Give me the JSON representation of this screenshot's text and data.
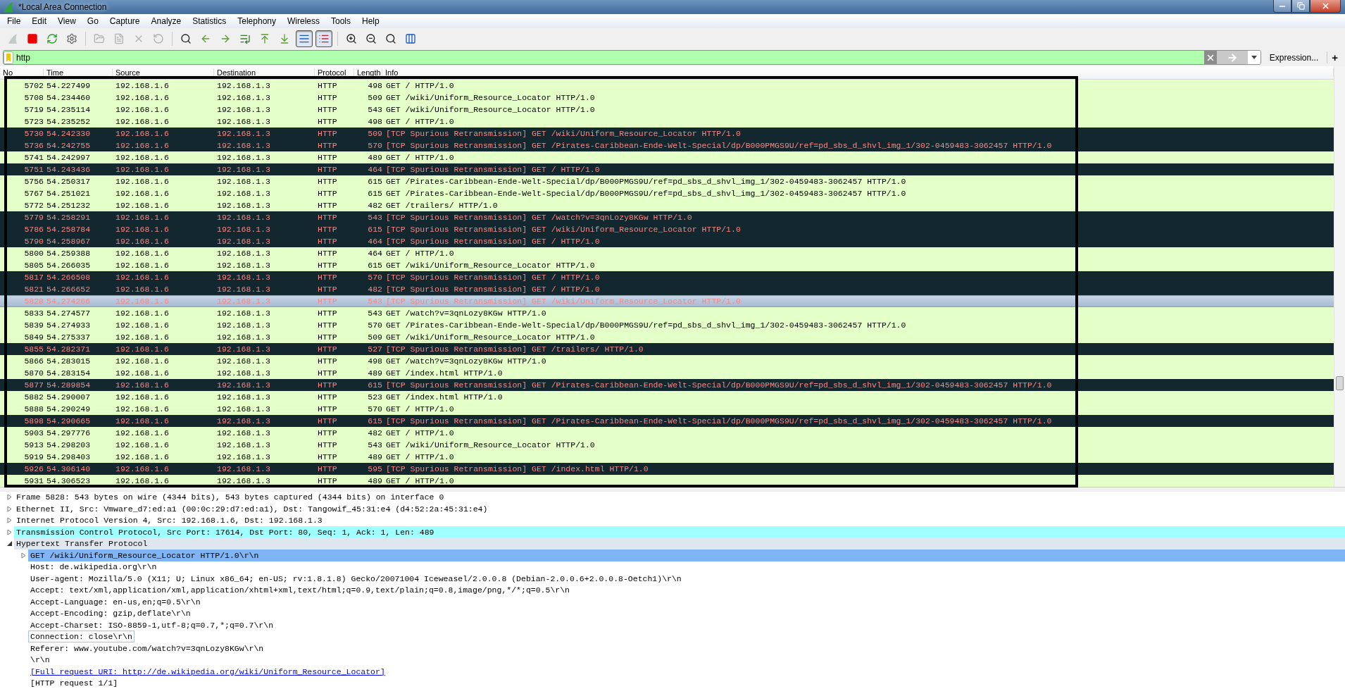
{
  "window": {
    "title": "*Local Area Connection"
  },
  "menu": [
    "File",
    "Edit",
    "View",
    "Go",
    "Capture",
    "Analyze",
    "Statistics",
    "Telephony",
    "Wireless",
    "Tools",
    "Help"
  ],
  "toolbar": [
    {
      "pressed": false,
      "disabled": true
    },
    {
      "pressed": false,
      "disabled": false
    },
    {
      "pressed": false,
      "disabled": false
    },
    {
      "pressed": false,
      "disabled": false
    },
    {
      "pressed": false,
      "disabled": true
    },
    {
      "pressed": false,
      "disabled": true
    },
    {
      "pressed": false,
      "disabled": true
    },
    {
      "pressed": false,
      "disabled": true
    },
    {
      "pressed": false,
      "disabled": false
    },
    {
      "pressed": false,
      "disabled": false
    },
    {
      "pressed": false,
      "disabled": false
    },
    {
      "pressed": false,
      "disabled": false
    },
    {
      "pressed": false,
      "disabled": false
    },
    {
      "pressed": false,
      "disabled": false
    },
    {
      "pressed": true,
      "disabled": false
    },
    {
      "pressed": true,
      "disabled": false
    },
    {
      "pressed": false,
      "disabled": false
    },
    {
      "pressed": false,
      "disabled": false
    },
    {
      "pressed": false,
      "disabled": false
    },
    {
      "pressed": false,
      "disabled": false
    }
  ],
  "filter": {
    "value": "http",
    "expression_button": "Expression...",
    "add_button": "+"
  },
  "packet_list": {
    "columns": [
      "No",
      "Time",
      "Source",
      "Destination",
      "Protocol",
      "Length",
      "Info"
    ],
    "rows": [
      {
        "no": "5702",
        "time": "54.227499",
        "source": "192.168.1.6",
        "destination": "192.168.1.3",
        "protocol": "HTTP",
        "length": "498",
        "info": "GET / HTTP/1.0",
        "kind": "normal",
        "selected": false
      },
      {
        "no": "5708",
        "time": "54.234460",
        "source": "192.168.1.6",
        "destination": "192.168.1.3",
        "protocol": "HTTP",
        "length": "509",
        "info": "GET /wiki/Uniform_Resource_Locator HTTP/1.0",
        "kind": "normal",
        "selected": false
      },
      {
        "no": "5719",
        "time": "54.235114",
        "source": "192.168.1.6",
        "destination": "192.168.1.3",
        "protocol": "HTTP",
        "length": "543",
        "info": "GET /wiki/Uniform_Resource_Locator HTTP/1.0",
        "kind": "normal",
        "selected": false
      },
      {
        "no": "5723",
        "time": "54.235252",
        "source": "192.168.1.6",
        "destination": "192.168.1.3",
        "protocol": "HTTP",
        "length": "498",
        "info": "GET / HTTP/1.0",
        "kind": "normal",
        "selected": false
      },
      {
        "no": "5730",
        "time": "54.242330",
        "source": "192.168.1.6",
        "destination": "192.168.1.3",
        "protocol": "HTTP",
        "length": "509",
        "info": "[TCP Spurious Retransmission] GET /wiki/Uniform_Resource_Locator HTTP/1.0",
        "kind": "retransmission",
        "selected": false
      },
      {
        "no": "5736",
        "time": "54.242755",
        "source": "192.168.1.6",
        "destination": "192.168.1.3",
        "protocol": "HTTP",
        "length": "570",
        "info": "[TCP Spurious Retransmission] GET /Pirates-Caribbean-Ende-Welt-Special/dp/B000PMGS9U/ref=pd_sbs_d_shvl_img_1/302-0459483-3062457 HTTP/1.0",
        "kind": "retransmission",
        "selected": false
      },
      {
        "no": "5741",
        "time": "54.242997",
        "source": "192.168.1.6",
        "destination": "192.168.1.3",
        "protocol": "HTTP",
        "length": "489",
        "info": "GET / HTTP/1.0",
        "kind": "normal",
        "selected": false
      },
      {
        "no": "5751",
        "time": "54.243436",
        "source": "192.168.1.6",
        "destination": "192.168.1.3",
        "protocol": "HTTP",
        "length": "464",
        "info": "[TCP Spurious Retransmission] GET / HTTP/1.0",
        "kind": "retransmission",
        "selected": false
      },
      {
        "no": "5756",
        "time": "54.250317",
        "source": "192.168.1.6",
        "destination": "192.168.1.3",
        "protocol": "HTTP",
        "length": "615",
        "info": "GET /Pirates-Caribbean-Ende-Welt-Special/dp/B000PMGS9U/ref=pd_sbs_d_shvl_img_1/302-0459483-3062457 HTTP/1.0",
        "kind": "normal",
        "selected": false
      },
      {
        "no": "5767",
        "time": "54.251021",
        "source": "192.168.1.6",
        "destination": "192.168.1.3",
        "protocol": "HTTP",
        "length": "615",
        "info": "GET /Pirates-Caribbean-Ende-Welt-Special/dp/B000PMGS9U/ref=pd_sbs_d_shvl_img_1/302-0459483-3062457 HTTP/1.0",
        "kind": "normal",
        "selected": false
      },
      {
        "no": "5772",
        "time": "54.251232",
        "source": "192.168.1.6",
        "destination": "192.168.1.3",
        "protocol": "HTTP",
        "length": "482",
        "info": "GET /trailers/ HTTP/1.0",
        "kind": "normal",
        "selected": false
      },
      {
        "no": "5779",
        "time": "54.258291",
        "source": "192.168.1.6",
        "destination": "192.168.1.3",
        "protocol": "HTTP",
        "length": "543",
        "info": "[TCP Spurious Retransmission] GET /watch?v=3qnLozy8KGw HTTP/1.0",
        "kind": "retransmission",
        "selected": false
      },
      {
        "no": "5786",
        "time": "54.258784",
        "source": "192.168.1.6",
        "destination": "192.168.1.3",
        "protocol": "HTTP",
        "length": "615",
        "info": "[TCP Spurious Retransmission] GET /wiki/Uniform_Resource_Locator HTTP/1.0",
        "kind": "retransmission",
        "selected": false
      },
      {
        "no": "5790",
        "time": "54.258967",
        "source": "192.168.1.6",
        "destination": "192.168.1.3",
        "protocol": "HTTP",
        "length": "464",
        "info": "[TCP Spurious Retransmission] GET / HTTP/1.0",
        "kind": "retransmission",
        "selected": false
      },
      {
        "no": "5800",
        "time": "54.259388",
        "source": "192.168.1.6",
        "destination": "192.168.1.3",
        "protocol": "HTTP",
        "length": "464",
        "info": "GET / HTTP/1.0",
        "kind": "normal",
        "selected": false
      },
      {
        "no": "5805",
        "time": "54.266035",
        "source": "192.168.1.6",
        "destination": "192.168.1.3",
        "protocol": "HTTP",
        "length": "615",
        "info": "GET /wiki/Uniform_Resource_Locator HTTP/1.0",
        "kind": "normal",
        "selected": false
      },
      {
        "no": "5817",
        "time": "54.266508",
        "source": "192.168.1.6",
        "destination": "192.168.1.3",
        "protocol": "HTTP",
        "length": "570",
        "info": "[TCP Spurious Retransmission] GET / HTTP/1.0",
        "kind": "retransmission",
        "selected": false
      },
      {
        "no": "5821",
        "time": "54.266652",
        "source": "192.168.1.6",
        "destination": "192.168.1.3",
        "protocol": "HTTP",
        "length": "482",
        "info": "[TCP Spurious Retransmission] GET / HTTP/1.0",
        "kind": "retransmission",
        "selected": false
      },
      {
        "no": "5828",
        "time": "54.274266",
        "source": "192.168.1.6",
        "destination": "192.168.1.3",
        "protocol": "HTTP",
        "length": "543",
        "info": "[TCP Spurious Retransmission] GET /wiki/Uniform_Resource_Locator HTTP/1.0",
        "kind": "retransmission",
        "selected": true
      },
      {
        "no": "5833",
        "time": "54.274577",
        "source": "192.168.1.6",
        "destination": "192.168.1.3",
        "protocol": "HTTP",
        "length": "543",
        "info": "GET /watch?v=3qnLozy8KGw HTTP/1.0",
        "kind": "normal",
        "selected": false
      },
      {
        "no": "5839",
        "time": "54.274933",
        "source": "192.168.1.6",
        "destination": "192.168.1.3",
        "protocol": "HTTP",
        "length": "570",
        "info": "GET /Pirates-Caribbean-Ende-Welt-Special/dp/B000PMGS9U/ref=pd_sbs_d_shvl_img_1/302-0459483-3062457 HTTP/1.0",
        "kind": "normal",
        "selected": false
      },
      {
        "no": "5849",
        "time": "54.275337",
        "source": "192.168.1.6",
        "destination": "192.168.1.3",
        "protocol": "HTTP",
        "length": "509",
        "info": "GET /wiki/Uniform_Resource_Locator HTTP/1.0",
        "kind": "normal",
        "selected": false
      },
      {
        "no": "5855",
        "time": "54.282371",
        "source": "192.168.1.6",
        "destination": "192.168.1.3",
        "protocol": "HTTP",
        "length": "527",
        "info": "[TCP Spurious Retransmission] GET /trailers/ HTTP/1.0",
        "kind": "retransmission",
        "selected": false
      },
      {
        "no": "5866",
        "time": "54.283015",
        "source": "192.168.1.6",
        "destination": "192.168.1.3",
        "protocol": "HTTP",
        "length": "498",
        "info": "GET /watch?v=3qnLozy8KGw HTTP/1.0",
        "kind": "normal",
        "selected": false
      },
      {
        "no": "5870",
        "time": "54.283154",
        "source": "192.168.1.6",
        "destination": "192.168.1.3",
        "protocol": "HTTP",
        "length": "489",
        "info": "GET /index.html HTTP/1.0",
        "kind": "normal",
        "selected": false
      },
      {
        "no": "5877",
        "time": "54.289854",
        "source": "192.168.1.6",
        "destination": "192.168.1.3",
        "protocol": "HTTP",
        "length": "615",
        "info": "[TCP Spurious Retransmission] GET /Pirates-Caribbean-Ende-Welt-Special/dp/B000PMGS9U/ref=pd_sbs_d_shvl_img_1/302-0459483-3062457 HTTP/1.0",
        "kind": "retransmission",
        "selected": false
      },
      {
        "no": "5882",
        "time": "54.290007",
        "source": "192.168.1.6",
        "destination": "192.168.1.3",
        "protocol": "HTTP",
        "length": "523",
        "info": "GET /index.html HTTP/1.0",
        "kind": "normal",
        "selected": false
      },
      {
        "no": "5888",
        "time": "54.290249",
        "source": "192.168.1.6",
        "destination": "192.168.1.3",
        "protocol": "HTTP",
        "length": "570",
        "info": "GET / HTTP/1.0",
        "kind": "normal",
        "selected": false
      },
      {
        "no": "5898",
        "time": "54.290665",
        "source": "192.168.1.6",
        "destination": "192.168.1.3",
        "protocol": "HTTP",
        "length": "615",
        "info": "[TCP Spurious Retransmission] GET /Pirates-Caribbean-Ende-Welt-Special/dp/B000PMGS9U/ref=pd_sbs_d_shvl_img_1/302-0459483-3062457 HTTP/1.0",
        "kind": "retransmission",
        "selected": false
      },
      {
        "no": "5903",
        "time": "54.297776",
        "source": "192.168.1.6",
        "destination": "192.168.1.3",
        "protocol": "HTTP",
        "length": "482",
        "info": "GET / HTTP/1.0",
        "kind": "normal",
        "selected": false
      },
      {
        "no": "5913",
        "time": "54.298203",
        "source": "192.168.1.6",
        "destination": "192.168.1.3",
        "protocol": "HTTP",
        "length": "543",
        "info": "GET /wiki/Uniform_Resource_Locator HTTP/1.0",
        "kind": "normal",
        "selected": false
      },
      {
        "no": "5919",
        "time": "54.298403",
        "source": "192.168.1.6",
        "destination": "192.168.1.3",
        "protocol": "HTTP",
        "length": "489",
        "info": "GET / HTTP/1.0",
        "kind": "normal",
        "selected": false
      },
      {
        "no": "5926",
        "time": "54.306140",
        "source": "192.168.1.6",
        "destination": "192.168.1.3",
        "protocol": "HTTP",
        "length": "595",
        "info": "[TCP Spurious Retransmission] GET /index.html HTTP/1.0",
        "kind": "retransmission",
        "selected": false
      },
      {
        "no": "5931",
        "time": "54.306523",
        "source": "192.168.1.6",
        "destination": "192.168.1.3",
        "protocol": "HTTP",
        "length": "489",
        "info": "GET / HTTP/1.0",
        "kind": "normal",
        "selected": false
      }
    ]
  },
  "details": [
    {
      "label": "Frame 5828: 543 bytes on wire (4344 bits), 543 bytes captured (4344 bits) on interface 0",
      "expanded": false,
      "selected": false
    },
    {
      "label": "Ethernet II, Src: Vmware_d7:ed:a1 (00:0c:29:d7:ed:a1), Dst: Tangowif_45:31:e4 (d4:52:2a:45:31:e4)",
      "expanded": false,
      "selected": false
    },
    {
      "label": "Internet Protocol Version 4, Src: 192.168.1.6, Dst: 192.168.1.3",
      "expanded": false,
      "selected": false
    },
    {
      "label": "Transmission Control Protocol, Src Port: 17614, Dst Port: 80, Seq: 1, Ack: 1, Len: 489",
      "expanded": false,
      "selected": false,
      "color": "#a0ffff"
    },
    {
      "label": "Hypertext Transfer Protocol",
      "expanded": true,
      "selected": false,
      "children": [
        {
          "label": "GET /wiki/Uniform_Resource_Locator HTTP/1.0\\r\\n",
          "kind": "field",
          "expanded": false,
          "selected": true,
          "focused": false
        },
        {
          "label": "Host: de.wikipedia.org\\r\\n",
          "kind": "field",
          "selected": false,
          "focused": false
        },
        {
          "label": "User-agent: Mozilla/5.0 (X11; U; Linux x86_64; en-US; rv:1.8.1.8) Gecko/20071004 Iceweasel/2.0.0.8 (Debian-2.0.0.6+2.0.0.8-Oetch1)\\r\\n",
          "kind": "field",
          "selected": false,
          "focused": false
        },
        {
          "label": "Accept: text/xml,application/xml,application/xhtml+xml,text/html;q=0.9,text/plain;q=0.8,image/png,*/*;q=0.5\\r\\n",
          "kind": "field",
          "selected": false,
          "focused": false
        },
        {
          "label": "Accept-Language: en-us,en;q=0.5\\r\\n",
          "kind": "field",
          "selected": false,
          "focused": false
        },
        {
          "label": "Accept-Encoding: gzip,deflate\\r\\n",
          "kind": "field",
          "selected": false,
          "focused": false
        },
        {
          "label": "Accept-Charset: ISO-8859-1,utf-8;q=0.7,*;q=0.7\\r\\n",
          "kind": "field",
          "selected": false,
          "focused": false
        },
        {
          "label": "Connection: close\\r\\n",
          "kind": "field",
          "selected": false,
          "focused": true
        },
        {
          "label": "Referer: www.youtube.com/watch?v=3qnLozy8KGw\\r\\n",
          "kind": "field",
          "selected": false,
          "focused": false
        },
        {
          "label": "\\r\\n",
          "kind": "field",
          "selected": false,
          "focused": false
        },
        {
          "label": "[Full request URI: http://de.wikipedia.org/wiki/Uniform_Resource_Locator]",
          "kind": "link",
          "selected": false,
          "focused": false
        },
        {
          "label": "[HTTP request 1/1]",
          "kind": "field",
          "selected": false,
          "focused": false
        }
      ]
    }
  ]
}
